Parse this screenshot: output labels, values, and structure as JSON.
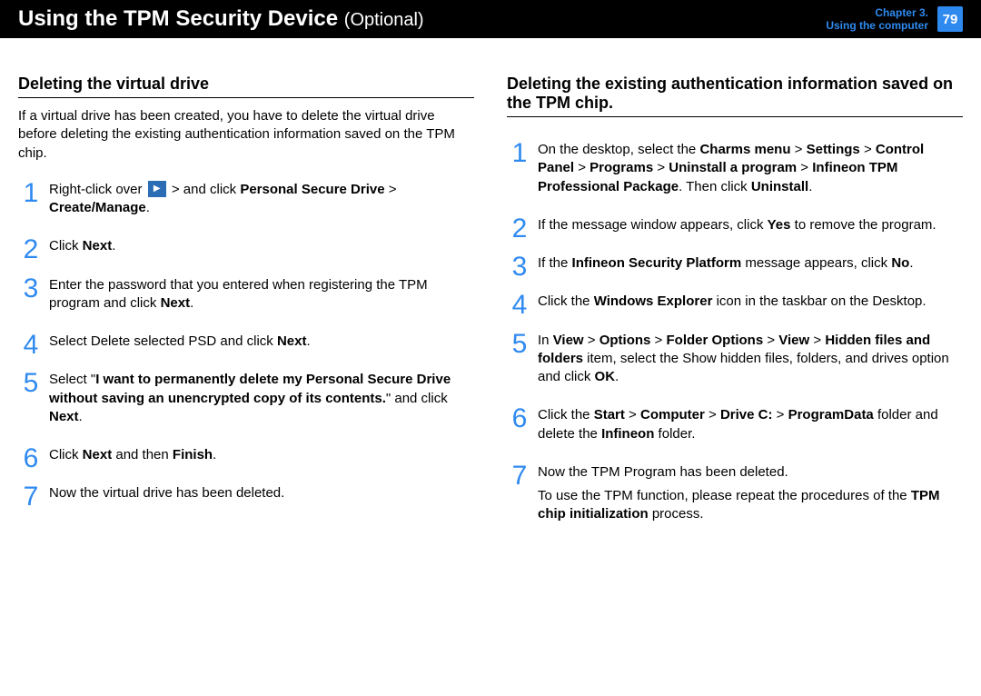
{
  "header": {
    "title_main": "Using the TPM Security Device",
    "title_optional": "(Optional)",
    "chapter_label": "Chapter 3.",
    "chapter_sub": "Using the computer",
    "page_number": "79"
  },
  "left": {
    "section_title": "Deleting the virtual drive",
    "intro": "If a virtual drive has been created, you have to delete the virtual drive before deleting the existing authentication information saved on the TPM chip.",
    "steps": {
      "s1a": "Right-click over ",
      "s1b": " >       and click ",
      "s1c": "Personal Secure Drive",
      "s1d": " > ",
      "s1e": "Create/Manage",
      "s1f": ".",
      "s2a": "Click ",
      "s2b": "Next",
      "s2c": ".",
      "s3a": "Enter the password that you entered when registering the TPM program and click ",
      "s3b": "Next",
      "s3c": ".",
      "s4a": "Select Delete selected PSD and click ",
      "s4b": "Next",
      "s4c": ".",
      "s5a": "Select \"",
      "s5b": "I want to permanently delete my Personal Secure Drive without saving an unencrypted copy of its contents.",
      "s5c": "\" and click ",
      "s5d": "Next",
      "s5e": ".",
      "s6a": "Click ",
      "s6b": "Next",
      "s6c": " and then ",
      "s6d": "Finish",
      "s6e": ".",
      "s7": "Now the virtual drive has been deleted."
    }
  },
  "right": {
    "section_title": "Deleting the existing authentication information saved on the TPM chip.",
    "steps": {
      "s1a": "On the desktop, select the ",
      "s1b": "Charms menu",
      "s1c": " > ",
      "s1d": "Settings",
      "s1e": " > ",
      "s1f": "Control Panel",
      "s1g": "  > ",
      "s1h": "Programs",
      "s1i": " > ",
      "s1j": "Uninstall a program",
      "s1k": " > ",
      "s1l": "Infineon TPM Professional Package",
      "s1m": ". Then click ",
      "s1n": "Uninstall",
      "s1o": ".",
      "s2a": "If the message window appears, click ",
      "s2b": "Yes",
      "s2c": " to remove the program.",
      "s3a": "If the ",
      "s3b": "Infineon Security Platform",
      "s3c": " message appears, click ",
      "s3d": "No",
      "s3e": ".",
      "s4a": "Click the ",
      "s4b": "Windows Explorer",
      "s4c": "        icon in the taskbar on the Desktop.",
      "s5a": "In ",
      "s5b": "View",
      "s5c": " > ",
      "s5d": "Options",
      "s5e": " > ",
      "s5f": "Folder Options",
      "s5g": " > ",
      "s5h": "View",
      "s5i": " > ",
      "s5j": "Hidden files and folders",
      "s5k": " item, select the Show hidden files, folders, and drives option and click ",
      "s5l": "OK",
      "s5m": ".",
      "s6a": "Click the ",
      "s6b": "Start",
      "s6c": " > ",
      "s6d": "Computer",
      "s6e": " > ",
      "s6f": "Drive C:",
      "s6g": " > ",
      "s6h": "ProgramData",
      "s6i": " folder and delete the ",
      "s6j": "Infineon",
      "s6k": " folder.",
      "s7a": "Now the TPM Program has been deleted.",
      "s7b": "To use the TPM function, please repeat the procedures of the ",
      "s7c": "TPM chip initialization",
      "s7d": " process."
    }
  }
}
